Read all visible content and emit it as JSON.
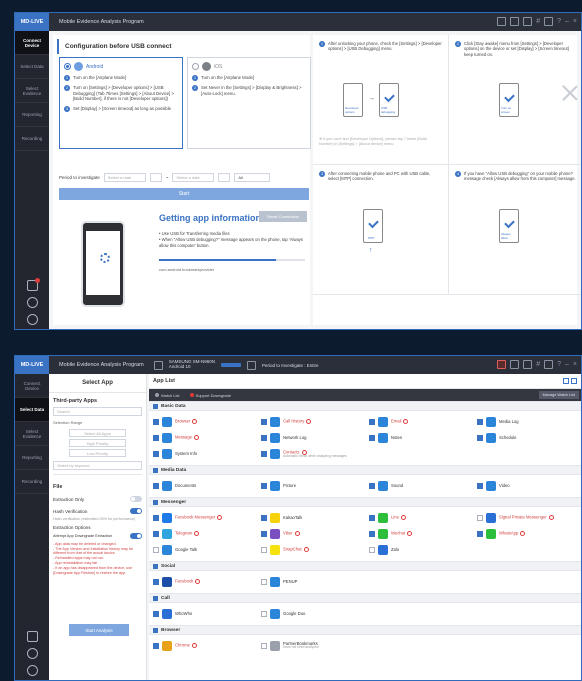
{
  "window1": {
    "brand": "MD-LIVE",
    "title": "Mobile Evidence Analysis Program",
    "sidebar": [
      "Connect Device",
      "Select Data",
      "Select Evidence",
      "Reporting",
      "Recording"
    ],
    "config_title": "Configuration before USB connect",
    "android": {
      "name": "Android",
      "steps": [
        "Turn on the [Airplane Mode]",
        "Turn on [Settings] > [Developer options] > [USB Debugging] (Tab 7times [Settings] > [About Device] > [Build Number], if there is not [Developer options])",
        "Set [Display] > [Screen timeout] as long as possible"
      ]
    },
    "ios": {
      "name": "iOS",
      "steps": [
        "Turn on the [Airplane Mode]",
        "Set Never in the [Settings] > [Display & Brightness] > [Auto-Lock] menu."
      ]
    },
    "period_label": "Period to investigate",
    "date_start_placeholder": "Select a date",
    "date_sep": "~",
    "date_end_placeholder": "Select a date",
    "period_select": "All",
    "start_label": "Start",
    "getting_title": "Getting app information.",
    "reset_label": "Reset Connection",
    "bullets": [
      "Use USB for Transferring media files",
      "When \"Allow USB debugging?\" message appears on the phone, tap 'Always allow this computer' button."
    ],
    "progress": 0.8,
    "package": "com.android.bookmarkprovider",
    "cards": [
      "After unlocking your phone, check the [Settings] > [Developer options] > [USB Debugging] menu.",
      "Click [Stay awake] menu from [Settings] > [Developer options] on the device or set [Display] > [Screen timeout] keep turned on.",
      "After connecting mobile phone and PC with USB cable, select [MTP] connection.",
      "If you have \"Allow USB debugging\" on your mobile phone? message check [Always allow from this computer] message."
    ],
    "card_note": "※ If you can't find [Developer Options], please tap 7 times [Build Number] in [Settings] > [About device] menu.",
    "mini_labels": [
      "Developer options",
      "USB debugging",
      "Turn on screen",
      "MTP",
      "Always allow"
    ]
  },
  "window2": {
    "brand": "MD-LIVE",
    "title": "Mobile Evidence Analysis Program",
    "device_model": "SAMSUNG SM-N960N",
    "device_os": "Android 10",
    "period_info": "Period to Investigate : Entire",
    "sidebar": [
      "Connect Device",
      "Select Data",
      "Select Evidence",
      "Reporting",
      "Recording"
    ],
    "select_app_title": "Select App",
    "third_party": "Third-party Apps",
    "search_placeholder": "Search",
    "selection_range": "Selection Range",
    "range_buttons": [
      "Select All Apps",
      "High Priority",
      "Low Priority"
    ],
    "select_by_keyword": "Select by keyword",
    "file_title": "File",
    "extraction_only": "Extraction Only",
    "hash_verification": "Hash Verification",
    "hash_note": "Hash verification (estimated 30% for performance)",
    "extraction_options": "Extraction Options",
    "attempt_downgrade": "Attempt App Downgrade Extraction",
    "downgrade_notes": [
      "- App data may be deleted or changed.",
      "- The App Version and Installation history may be different from that of the actual device.",
      "- Reinstalled apps may not run.",
      "- App reinstallation may fail.",
      "- If an app has disappeared from the device, use [Downgrade App Restore] to restore the app."
    ],
    "analyze_label": "Start Analysis",
    "app_list_title": "App List",
    "filter_watch": "Watch List",
    "filter_downgrade": "Support Downgrade",
    "manage_label": "Manage Watch List",
    "categories": [
      {
        "name": "Basic Data",
        "apps": [
          {
            "name": "Browser",
            "color": "#2b86d9",
            "on": true,
            "red": true,
            "sub": ""
          },
          {
            "name": "Call History",
            "color": "#2b86d9",
            "on": true,
            "red": true,
            "sub": ""
          },
          {
            "name": "Email",
            "color": "#2b86d9",
            "on": true,
            "red": true,
            "sub": ""
          },
          {
            "name": "Media Log",
            "color": "#2b86d9",
            "on": true,
            "red": false,
            "sub": ""
          },
          {
            "name": "Message",
            "color": "#2b86d9",
            "on": true,
            "red": true,
            "sub": ""
          },
          {
            "name": "Network Log",
            "color": "#2b86d9",
            "on": true,
            "red": false,
            "sub": ""
          },
          {
            "name": "Notes",
            "color": "#2b86d9",
            "on": true,
            "red": false,
            "sub": ""
          },
          {
            "name": "Schedule",
            "color": "#2b86d9",
            "on": true,
            "red": false,
            "sub": ""
          },
          {
            "name": "System Info",
            "color": "#2b86d9",
            "on": true,
            "red": false,
            "sub": ""
          },
          {
            "name": "Contacts",
            "color": "#2b86d9",
            "on": true,
            "red": true,
            "sub": "Automatic check when analyzing messages"
          }
        ]
      },
      {
        "name": "Media Data",
        "apps": [
          {
            "name": "Documents",
            "color": "#2b86d9",
            "on": true,
            "red": false,
            "sub": ""
          },
          {
            "name": "Picture",
            "color": "#2b86d9",
            "on": true,
            "red": false,
            "sub": ""
          },
          {
            "name": "Sound",
            "color": "#2b86d9",
            "on": true,
            "red": false,
            "sub": ""
          },
          {
            "name": "Video",
            "color": "#2b86d9",
            "on": true,
            "red": false,
            "sub": ""
          }
        ]
      },
      {
        "name": "Messenger",
        "apps": [
          {
            "name": "Facebook Messenger",
            "color": "#1e7ae6",
            "on": true,
            "red": true,
            "sub": ""
          },
          {
            "name": "KakaoTalk",
            "color": "#f5d20b",
            "on": true,
            "red": false,
            "sub": ""
          },
          {
            "name": "Line",
            "color": "#2dbf3c",
            "on": true,
            "red": true,
            "sub": ""
          },
          {
            "name": "Signal Private Messenger",
            "color": "#2a6fd6",
            "on": false,
            "red": true,
            "sub": ""
          },
          {
            "name": "Telegram",
            "color": "#2ea5de",
            "on": true,
            "red": true,
            "sub": ""
          },
          {
            "name": "Viber",
            "color": "#7b4fbf",
            "on": true,
            "red": true,
            "sub": ""
          },
          {
            "name": "Wechat",
            "color": "#2dbf3c",
            "on": true,
            "red": true,
            "sub": ""
          },
          {
            "name": "WhatsApp",
            "color": "#2dbf3c",
            "on": true,
            "red": true,
            "sub": ""
          },
          {
            "name": "Google Talk",
            "color": "#2b86d9",
            "on": false,
            "red": false,
            "sub": ""
          },
          {
            "name": "SnapChat",
            "color": "#f5e30b",
            "on": false,
            "red": true,
            "sub": ""
          },
          {
            "name": "Zalo",
            "color": "#2a6fd6",
            "on": false,
            "red": false,
            "sub": ""
          }
        ]
      },
      {
        "name": "Social",
        "apps": [
          {
            "name": "Facebook",
            "color": "#1e4fa8",
            "on": true,
            "red": true,
            "sub": ""
          },
          {
            "name": "PENUP",
            "color": "#2b86d9",
            "on": false,
            "red": false,
            "sub": ""
          }
        ]
      },
      {
        "name": "Call",
        "apps": [
          {
            "name": "WhoWho",
            "color": "#2a6fd6",
            "on": true,
            "red": false,
            "sub": ""
          },
          {
            "name": "Google Duo",
            "color": "#2b86d9",
            "on": false,
            "red": false,
            "sub": ""
          }
        ]
      },
      {
        "name": "Browser",
        "apps": [
          {
            "name": "Chrome",
            "color": "#e8a21a",
            "on": true,
            "red": true,
            "sub": ""
          },
          {
            "name": "PartnerBookmarks",
            "color": "#9aa1ad",
            "on": false,
            "red": false,
            "sub": "Does not need analyzed"
          }
        ]
      }
    ]
  }
}
